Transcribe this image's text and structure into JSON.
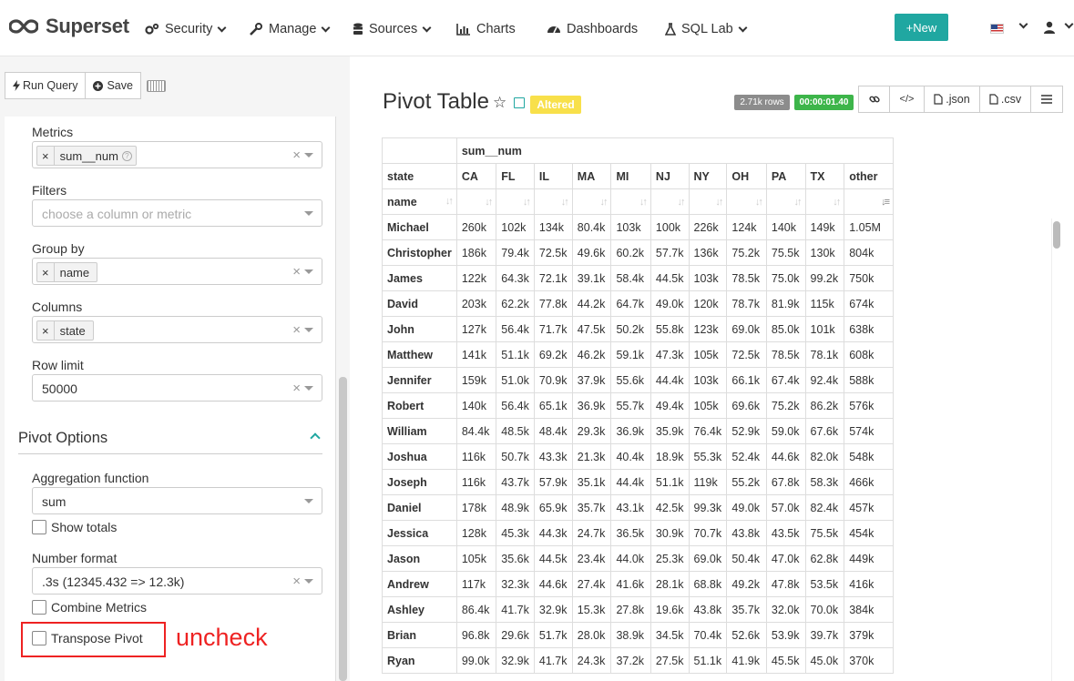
{
  "nav": {
    "brand": "Superset",
    "items": [
      {
        "label": "Security",
        "icon": "gears-icon",
        "dropdown": true
      },
      {
        "label": "Manage",
        "icon": "wrench-icon",
        "dropdown": true
      },
      {
        "label": "Sources",
        "icon": "database-icon",
        "dropdown": true
      },
      {
        "label": "Charts",
        "icon": "bar-chart-icon",
        "dropdown": false
      },
      {
        "label": "Dashboards",
        "icon": "dashboard-icon",
        "dropdown": false
      },
      {
        "label": "SQL Lab",
        "icon": "flask-icon",
        "dropdown": true
      }
    ],
    "new_label": "+New",
    "accent": "#20a7a1"
  },
  "toolbar": {
    "run_label": "Run Query",
    "save_label": "Save"
  },
  "controls": {
    "metrics": {
      "label": "Metrics",
      "tag": "sum__num"
    },
    "filters": {
      "label": "Filters",
      "placeholder": "choose a column or metric"
    },
    "groupby": {
      "label": "Group by",
      "tag": "name"
    },
    "columns": {
      "label": "Columns",
      "tag": "state"
    },
    "row_limit": {
      "label": "Row limit",
      "value": "50000"
    },
    "pivot_section": "Pivot Options",
    "aggregation": {
      "label": "Aggregation function",
      "value": "sum"
    },
    "show_totals": "Show totals",
    "number_format": {
      "label": "Number format",
      "value": ".3s (12345.432 => 12.3k)"
    },
    "combine_metrics": "Combine Metrics",
    "transpose_pivot": "Transpose Pivot"
  },
  "annotation": "uncheck",
  "chart": {
    "title": "Pivot Table",
    "altered": "Altered",
    "rows_badge": "2.71k rows",
    "time_badge": "00:00:01.40",
    "json_label": ".json",
    "csv_label": ".csv"
  },
  "table": {
    "metric_header": "sum__num",
    "column_header": "state",
    "row_header": "name",
    "columns": [
      "CA",
      "FL",
      "IL",
      "MA",
      "MI",
      "NJ",
      "NY",
      "OH",
      "PA",
      "TX",
      "other"
    ],
    "rows": [
      {
        "name": "Michael",
        "values": [
          "260k",
          "102k",
          "134k",
          "80.4k",
          "103k",
          "100k",
          "226k",
          "124k",
          "140k",
          "149k",
          "1.05M"
        ]
      },
      {
        "name": "Christopher",
        "values": [
          "186k",
          "79.4k",
          "72.5k",
          "49.6k",
          "60.2k",
          "57.7k",
          "136k",
          "75.2k",
          "75.5k",
          "130k",
          "804k"
        ]
      },
      {
        "name": "James",
        "values": [
          "122k",
          "64.3k",
          "72.1k",
          "39.1k",
          "58.4k",
          "44.5k",
          "103k",
          "78.5k",
          "75.0k",
          "99.2k",
          "750k"
        ]
      },
      {
        "name": "David",
        "values": [
          "203k",
          "62.2k",
          "77.8k",
          "44.2k",
          "64.7k",
          "49.0k",
          "120k",
          "78.7k",
          "81.9k",
          "115k",
          "674k"
        ]
      },
      {
        "name": "John",
        "values": [
          "127k",
          "56.4k",
          "71.7k",
          "47.5k",
          "50.2k",
          "55.8k",
          "123k",
          "69.0k",
          "85.0k",
          "101k",
          "638k"
        ]
      },
      {
        "name": "Matthew",
        "values": [
          "141k",
          "51.1k",
          "69.2k",
          "46.2k",
          "59.1k",
          "47.3k",
          "105k",
          "72.5k",
          "78.5k",
          "78.1k",
          "608k"
        ]
      },
      {
        "name": "Jennifer",
        "values": [
          "159k",
          "51.0k",
          "70.9k",
          "37.9k",
          "55.6k",
          "44.4k",
          "103k",
          "66.1k",
          "67.4k",
          "92.4k",
          "588k"
        ]
      },
      {
        "name": "Robert",
        "values": [
          "140k",
          "56.4k",
          "65.1k",
          "36.9k",
          "55.7k",
          "49.4k",
          "105k",
          "69.6k",
          "75.2k",
          "86.2k",
          "576k"
        ]
      },
      {
        "name": "William",
        "values": [
          "84.4k",
          "48.5k",
          "48.4k",
          "29.3k",
          "36.9k",
          "35.9k",
          "76.4k",
          "52.9k",
          "59.0k",
          "67.6k",
          "574k"
        ]
      },
      {
        "name": "Joshua",
        "values": [
          "116k",
          "50.7k",
          "43.3k",
          "21.3k",
          "40.4k",
          "18.9k",
          "55.3k",
          "52.4k",
          "44.6k",
          "82.0k",
          "548k"
        ]
      },
      {
        "name": "Joseph",
        "values": [
          "116k",
          "43.7k",
          "57.9k",
          "35.1k",
          "44.4k",
          "51.1k",
          "119k",
          "55.2k",
          "67.8k",
          "58.3k",
          "466k"
        ]
      },
      {
        "name": "Daniel",
        "values": [
          "178k",
          "48.9k",
          "65.9k",
          "35.7k",
          "43.1k",
          "42.5k",
          "99.3k",
          "49.0k",
          "57.0k",
          "82.4k",
          "457k"
        ]
      },
      {
        "name": "Jessica",
        "values": [
          "128k",
          "45.3k",
          "44.3k",
          "24.7k",
          "36.5k",
          "30.9k",
          "70.7k",
          "43.8k",
          "43.5k",
          "75.5k",
          "454k"
        ]
      },
      {
        "name": "Jason",
        "values": [
          "105k",
          "35.6k",
          "44.5k",
          "23.4k",
          "44.0k",
          "25.3k",
          "69.0k",
          "50.4k",
          "47.0k",
          "62.8k",
          "449k"
        ]
      },
      {
        "name": "Andrew",
        "values": [
          "117k",
          "32.3k",
          "44.6k",
          "27.4k",
          "41.6k",
          "28.1k",
          "68.8k",
          "49.2k",
          "47.8k",
          "53.5k",
          "416k"
        ]
      },
      {
        "name": "Ashley",
        "values": [
          "86.4k",
          "41.7k",
          "32.9k",
          "15.3k",
          "27.8k",
          "19.6k",
          "43.8k",
          "35.7k",
          "32.0k",
          "70.0k",
          "384k"
        ]
      },
      {
        "name": "Brian",
        "values": [
          "96.8k",
          "29.6k",
          "51.7k",
          "28.0k",
          "38.9k",
          "34.5k",
          "70.4k",
          "52.6k",
          "53.9k",
          "39.7k",
          "379k"
        ]
      },
      {
        "name": "Ryan",
        "values": [
          "99.0k",
          "32.9k",
          "41.7k",
          "24.3k",
          "37.2k",
          "27.5k",
          "51.1k",
          "41.9k",
          "45.5k",
          "45.0k",
          "370k"
        ]
      }
    ]
  }
}
